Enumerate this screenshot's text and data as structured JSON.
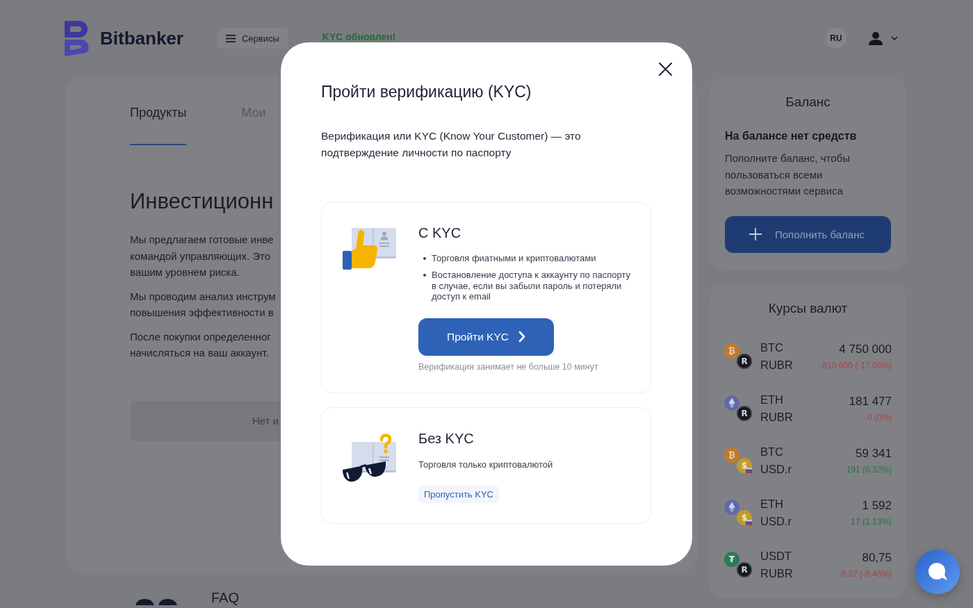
{
  "header": {
    "brand": "Bitbanker",
    "services_button": "Сервисы",
    "notice": "KYC обновлен!",
    "language": "RU"
  },
  "products": {
    "tabs": [
      {
        "label": "Продукты",
        "selected": true
      },
      {
        "label": "Мои",
        "selected": false
      }
    ],
    "heading": "Инвестиционн",
    "paragraphs": [
      {
        "lines": [
          "Мы предлагаем готовые инве",
          "командой управляющих. Это",
          "вашим уровнем риска."
        ]
      },
      {
        "lines": [
          "Мы проводим анализ инструм",
          "повышения эффективности в"
        ]
      },
      {
        "lines": [
          "После покупки определенног",
          "начисляться на ваш аккаунт."
        ]
      }
    ],
    "empty_state": "Нет и",
    "faq_title": "FAQ"
  },
  "balance": {
    "title": "Баланс",
    "empty_title": "На балансе нет средств",
    "text": "Пополните баланс, чтобы пользоваться всеми возможностями сервиса",
    "button": "Пополнить баланс"
  },
  "rates": {
    "title": "Курсы валют",
    "rows": [
      {
        "coins": [
          {
            "code": "BTC",
            "kind": "bitcoin",
            "symbol": "₿"
          },
          {
            "code": "RUBR",
            "kind": "ruble",
            "symbol": "R"
          }
        ],
        "price": "4 750 000",
        "change": "-810 000 (-17.05%)",
        "negative": true
      },
      {
        "coins": [
          {
            "code": "ETH",
            "kind": "ether"
          },
          {
            "code": "RUBR",
            "kind": "ruble",
            "symbol": "R"
          }
        ],
        "price": "181 477",
        "change": "0 (0%)",
        "negative": true
      },
      {
        "coins": [
          {
            "code": "BTC",
            "kind": "bitcoin",
            "symbol": "₿"
          },
          {
            "code": "USD.r",
            "kind": "dollar",
            "symbol": "$"
          }
        ],
        "price": "59 341",
        "change": "191 (0.32%)",
        "negative": false
      },
      {
        "coins": [
          {
            "code": "ETH",
            "kind": "ether"
          },
          {
            "code": "USD.r",
            "kind": "dollar",
            "symbol": "$"
          }
        ],
        "price": "1 592",
        "change": "17 (1.13%)",
        "negative": false
      },
      {
        "coins": [
          {
            "code": "USDT",
            "kind": "tether",
            "symbol": "₮"
          },
          {
            "code": "RUBR",
            "kind": "ruble",
            "symbol": "R"
          }
        ],
        "price": "80,75",
        "change": "-0,37 (-0.46%)",
        "negative": true
      }
    ]
  },
  "modal": {
    "title": "Пройти верификацию (KYC)",
    "description": "Верификация или KYC (Know Your Customer) — это подтверждение личности по паспорту",
    "options": [
      {
        "kind": "verified",
        "title": "С KYC",
        "features": [
          "Торговля фиатными и криптовалютами",
          "Востановление доступа к аккаунту по паспорту в случае, если вы забыли пароль и потеряли доступ к email"
        ],
        "button": "Пройти KYC",
        "note": "Верификация занимает не больше 10 минут"
      },
      {
        "kind": "anonymous",
        "title": "Без KYC",
        "text": "Торговля только криптовалютой",
        "link": "Пропустить KYC"
      }
    ]
  }
}
